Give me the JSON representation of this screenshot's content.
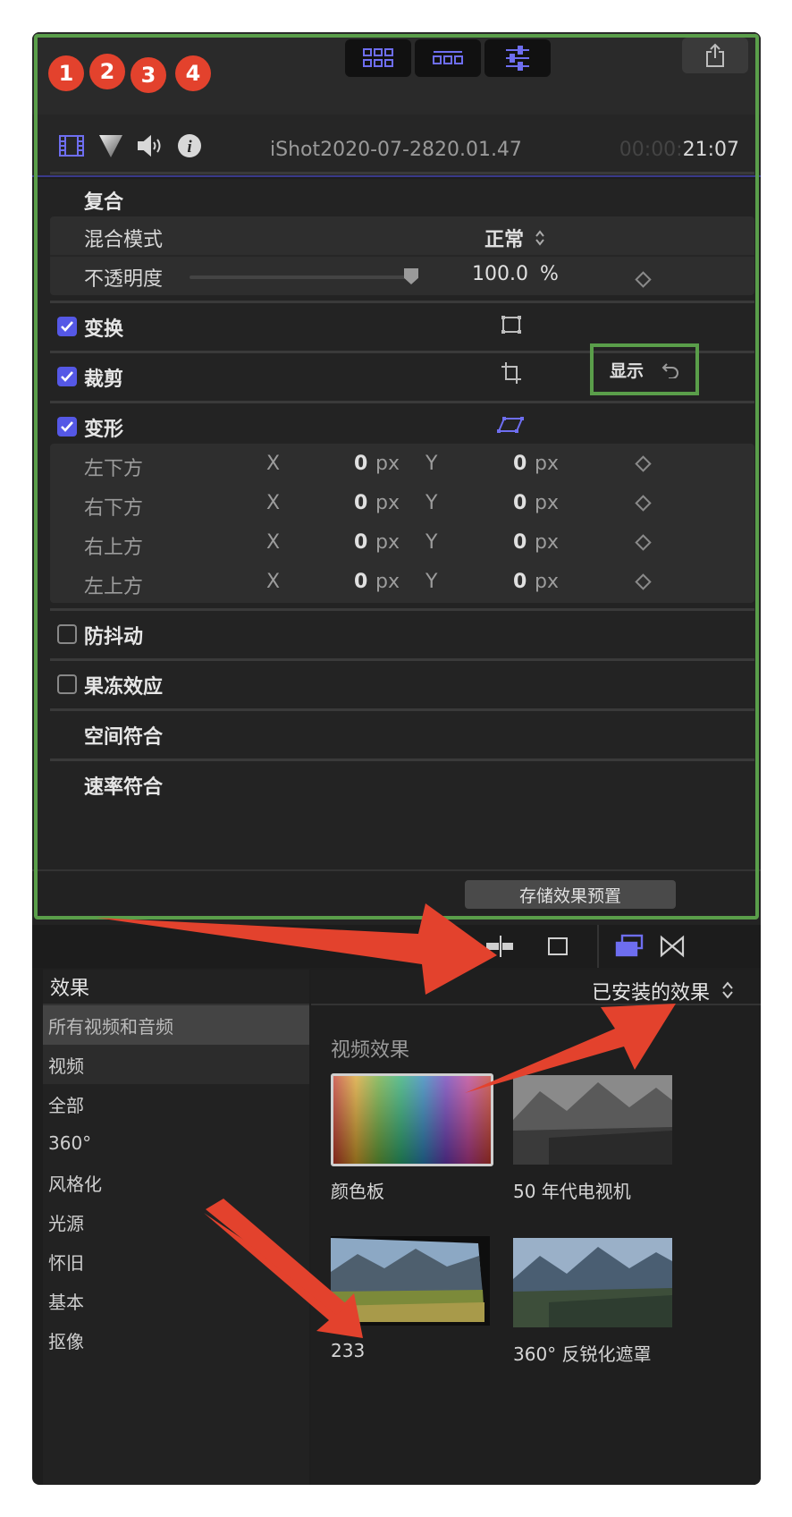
{
  "toolbar": {
    "view_buttons": [
      "grid-view-icon",
      "filmstrip-view-icon",
      "inspector-view-icon"
    ],
    "share_icon": "share-icon"
  },
  "tabs": {
    "badges": [
      "1",
      "2",
      "3",
      "4"
    ],
    "icons": [
      "video-inspector-icon",
      "color-inspector-icon",
      "audio-inspector-icon",
      "info-inspector-icon"
    ],
    "clip_title": "iShot2020-07-2820.01.47",
    "timecode_prefix": "00:00:",
    "timecode_main": "21:07"
  },
  "inspector": {
    "compositing": {
      "title": "复合",
      "blend_label": "混合模式",
      "blend_value": "正常",
      "opacity_label": "不透明度",
      "opacity_value": "100.0",
      "opacity_unit": "%",
      "opacity_level": 1.0
    },
    "transform": {
      "label": "变换",
      "checked": true
    },
    "crop": {
      "label": "裁剪",
      "checked": true,
      "show_label": "显示"
    },
    "distort": {
      "label": "变形",
      "checked": true,
      "axis_x": "X",
      "axis_y": "Y",
      "unit": "px",
      "rows": [
        {
          "label": "左下方",
          "x": "0",
          "y": "0"
        },
        {
          "label": "右下方",
          "x": "0",
          "y": "0"
        },
        {
          "label": "右上方",
          "x": "0",
          "y": "0"
        },
        {
          "label": "左上方",
          "x": "0",
          "y": "0"
        }
      ]
    },
    "stabilization": {
      "label": "防抖动",
      "checked": false
    },
    "rolling_shutter": {
      "label": "果冻效应",
      "checked": false
    },
    "spatial_conform": {
      "label": "空间符合"
    },
    "rate_conform": {
      "label": "速率符合"
    },
    "save_preset": "存储效果预置"
  },
  "effects": {
    "sidebar_title": "效果",
    "sidebar_items": [
      "所有视频和音频",
      "视频",
      "全部",
      "360°",
      "风格化",
      "光源",
      "怀旧",
      "基本",
      "抠像"
    ],
    "installed_label": "已安装的效果",
    "category_label": "视频效果",
    "items": [
      {
        "label": "颜色板"
      },
      {
        "label": "50 年代电视机"
      },
      {
        "label": "233"
      },
      {
        "label": "360° 反锐化遮罩"
      }
    ]
  },
  "colors": {
    "accent": "#5558e6",
    "annotation_red": "#e3422d",
    "highlight_green": "#5a9e4a"
  }
}
